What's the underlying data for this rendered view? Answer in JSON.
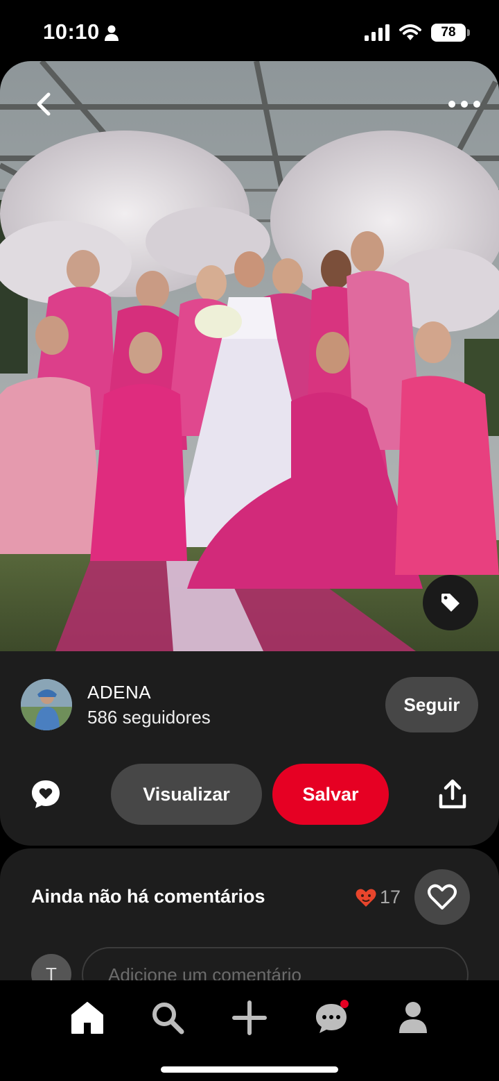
{
  "status_bar": {
    "time": "10:10",
    "battery": "78"
  },
  "pin": {
    "image_alt": "Noiva de vestido branco com madrinhas de vestidos rosa sob árvores floridas",
    "author": {
      "name": "ADENA",
      "followers": "586 seguidores"
    },
    "follow_label": "Seguir",
    "visualize_label": "Visualizar",
    "save_label": "Salvar"
  },
  "comments": {
    "empty_text": "Ainda não há comentários",
    "reaction_count": "17",
    "commenter_initial": "T",
    "input_placeholder": "Adicione um comentário"
  },
  "colors": {
    "accent": "#e60023",
    "card": "#1d1d1d",
    "pill": "#474747"
  },
  "icons": [
    "chevron-left-icon",
    "more-icon",
    "tag-icon",
    "comment-heart-icon",
    "share-icon",
    "heart-outline-icon",
    "home-icon",
    "search-icon",
    "plus-icon",
    "messages-icon",
    "profile-icon"
  ]
}
